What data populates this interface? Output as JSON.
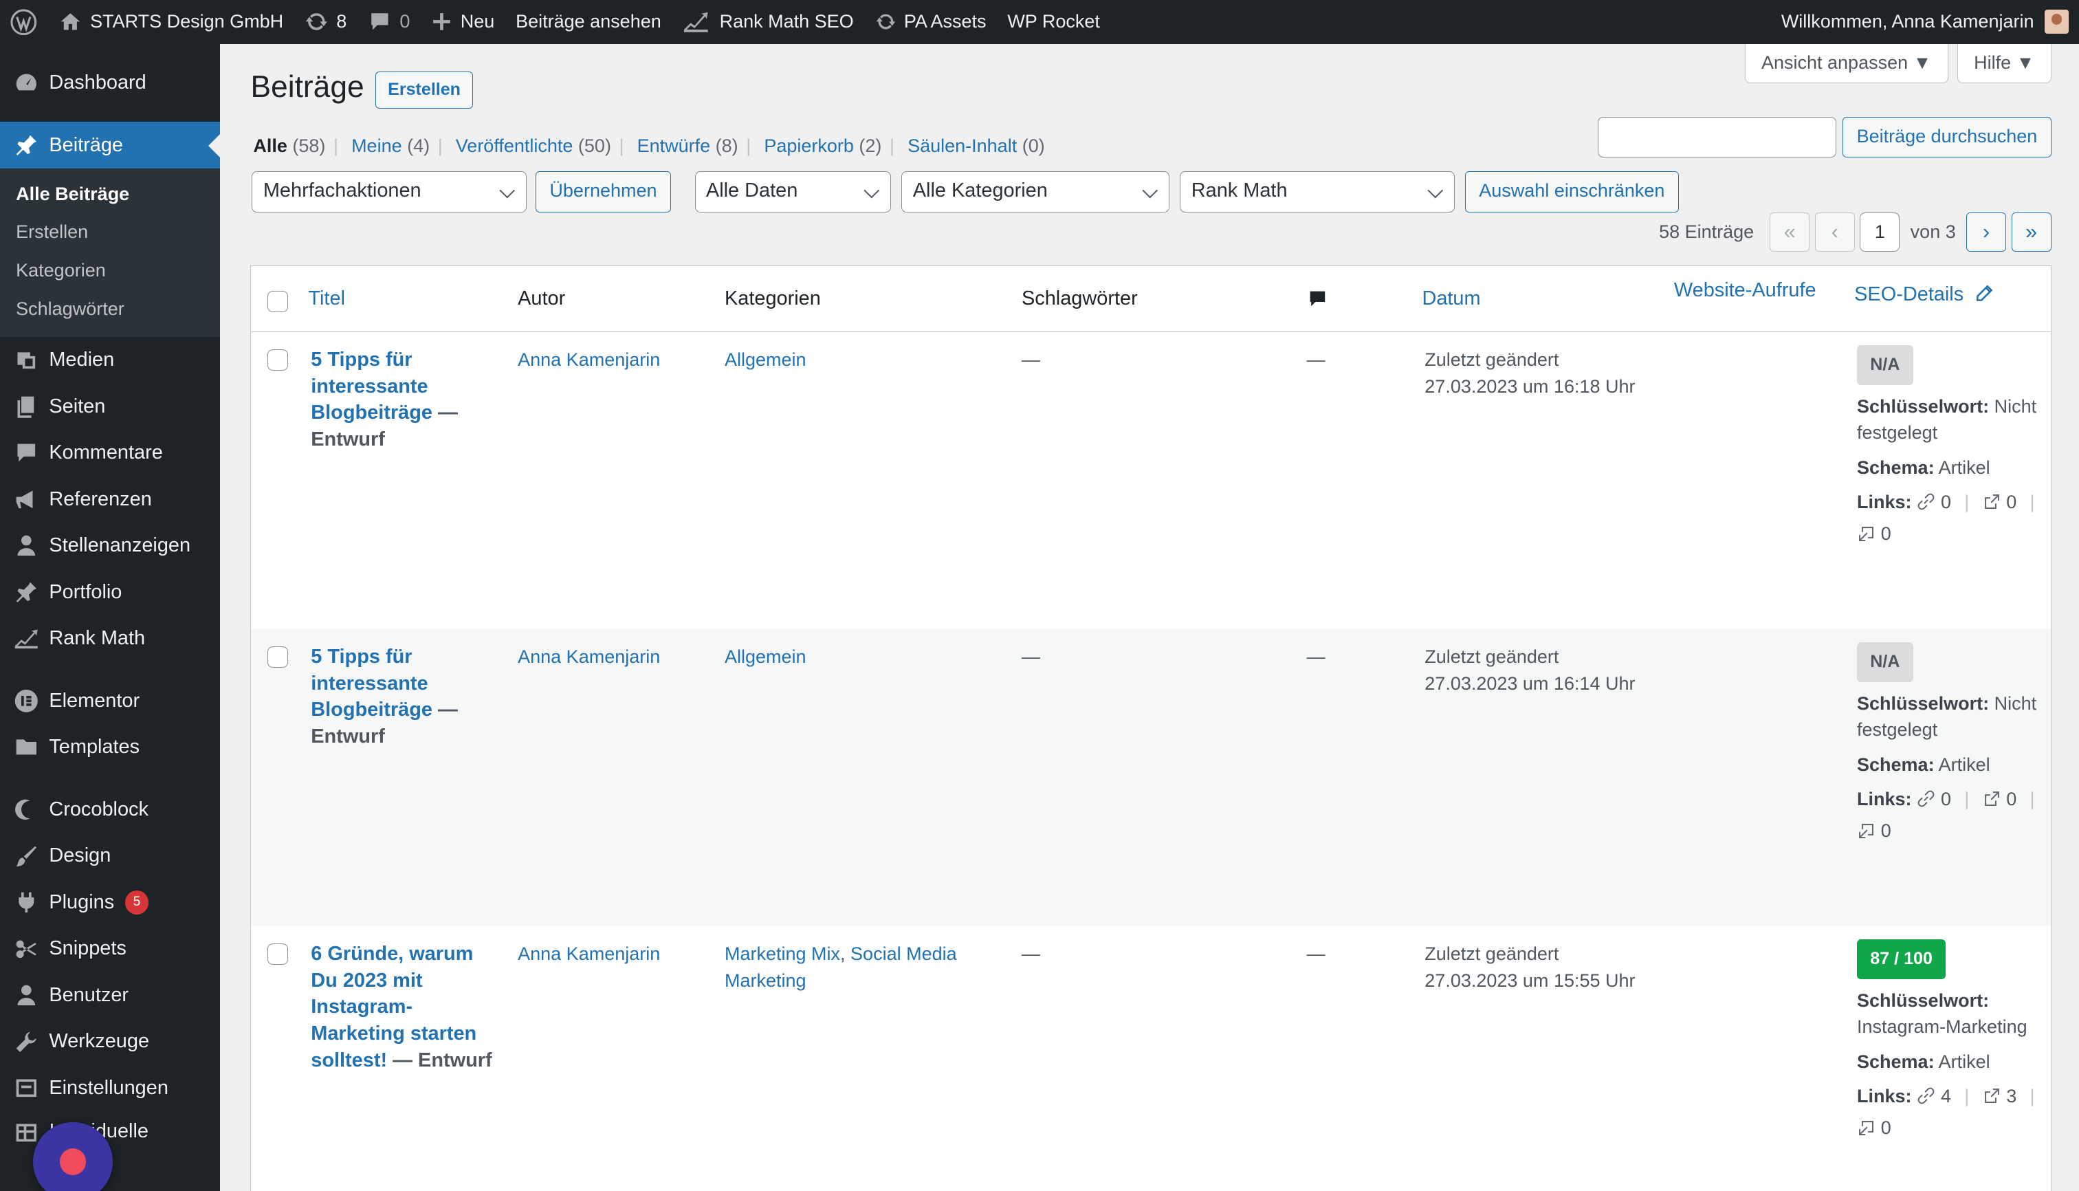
{
  "adminbar": {
    "site_name": "STARTS Design GmbH",
    "updates_count": "8",
    "comments_count": "0",
    "new_label": "Neu",
    "view_posts": "Beiträge ansehen",
    "rank_math": "Rank Math SEO",
    "pa_assets": "PA Assets",
    "wp_rocket": "WP Rocket",
    "greeting": "Willkommen, Anna Kamenjarin"
  },
  "sidebar": {
    "dashboard": "Dashboard",
    "posts": "Beiträge",
    "sub_all": "Alle Beiträge",
    "sub_create": "Erstellen",
    "sub_categories": "Kategorien",
    "sub_tags": "Schlagwörter",
    "media": "Medien",
    "pages": "Seiten",
    "comments": "Kommentare",
    "references": "Referenzen",
    "jobs": "Stellenanzeigen",
    "portfolio": "Portfolio",
    "rankmath": "Rank Math",
    "elementor": "Elementor",
    "templates": "Templates",
    "crocoblock": "Crocoblock",
    "design": "Design",
    "plugins": "Plugins",
    "plugins_badge": "5",
    "snippets": "Snippets",
    "users": "Benutzer",
    "tools": "Werkzeuge",
    "settings": "Einstellungen",
    "custom_fields": "Individuelle Felder"
  },
  "screen_options": {
    "view": "Ansicht anpassen ▼",
    "help": "Hilfe ▼"
  },
  "page": {
    "title": "Beiträge",
    "create_button": "Erstellen",
    "search_button": "Beiträge durchsuchen",
    "filters": {
      "all": "Alle",
      "all_count": "(58)",
      "mine": "Meine",
      "mine_count": "(4)",
      "published": "Veröffentlichte",
      "published_count": "(50)",
      "drafts": "Entwürfe",
      "drafts_count": "(8)",
      "trash": "Papierkorb",
      "trash_count": "(2)",
      "columns": "Säulen-Inhalt",
      "columns_count": "(0)"
    },
    "bulk_select": "Mehrfachaktionen",
    "apply_button": "Übernehmen",
    "dates_select": "Alle Daten",
    "categories_select": "Alle Kategorien",
    "rankmath_select": "Rank Math",
    "filter_button": "Auswahl einschränken",
    "items_count": "58 Einträge",
    "page_current": "1",
    "page_of": "von 3"
  },
  "table": {
    "headers": {
      "title": "Titel",
      "author": "Autor",
      "categories": "Kategorien",
      "tags": "Schlagwörter",
      "date": "Datum",
      "views": "Website-Aufrufe",
      "seo": "SEO-Details"
    },
    "rows": [
      {
        "title": "5 Tipps für interessante Blogbeiträge",
        "state": "— Entwurf",
        "author": "Anna Kamenjarin",
        "category": "Allgemein",
        "category2": "",
        "tags": "—",
        "comments": "—",
        "date_label": "Zuletzt geändert",
        "date": "27.03.2023 um 16:18 Uhr",
        "score": "N/A",
        "kw_label": "Schlüsselwort:",
        "kw": "Nicht festgelegt",
        "schema_label": "Schema:",
        "schema": "Artikel",
        "links_label": "Links:",
        "l_internal": "0",
        "l_external": "0",
        "l_incoming": "0"
      },
      {
        "title": "5 Tipps für interessante Blogbeiträge",
        "state": "— Entwurf",
        "author": "Anna Kamenjarin",
        "category": "Allgemein",
        "category2": "",
        "tags": "—",
        "comments": "—",
        "date_label": "Zuletzt geändert",
        "date": "27.03.2023 um 16:14 Uhr",
        "score": "N/A",
        "kw_label": "Schlüsselwort:",
        "kw": "Nicht festgelegt",
        "schema_label": "Schema:",
        "schema": "Artikel",
        "links_label": "Links:",
        "l_internal": "0",
        "l_external": "0",
        "l_incoming": "0"
      },
      {
        "title": "6 Gründe, warum Du 2023 mit Instagram-Marketing starten solltest!",
        "state": "— Entwurf",
        "author": "Anna Kamenjarin",
        "category": "Marketing Mix",
        "category2": "Social Media Marketing",
        "tags": "—",
        "comments": "—",
        "date_label": "Zuletzt geändert",
        "date": "27.03.2023 um 15:55 Uhr",
        "score": "87 / 100",
        "kw_label": "Schlüsselwort:",
        "kw": "Instagram-Marketing",
        "schema_label": "Schema:",
        "schema": "Artikel",
        "links_label": "Links:",
        "l_internal": "4",
        "l_external": "3",
        "l_incoming": "0"
      }
    ]
  },
  "colors": {
    "accent": "#2271b1",
    "sidebar": "#1d2327",
    "score_good": "#10a649",
    "badge": "#d63638"
  }
}
